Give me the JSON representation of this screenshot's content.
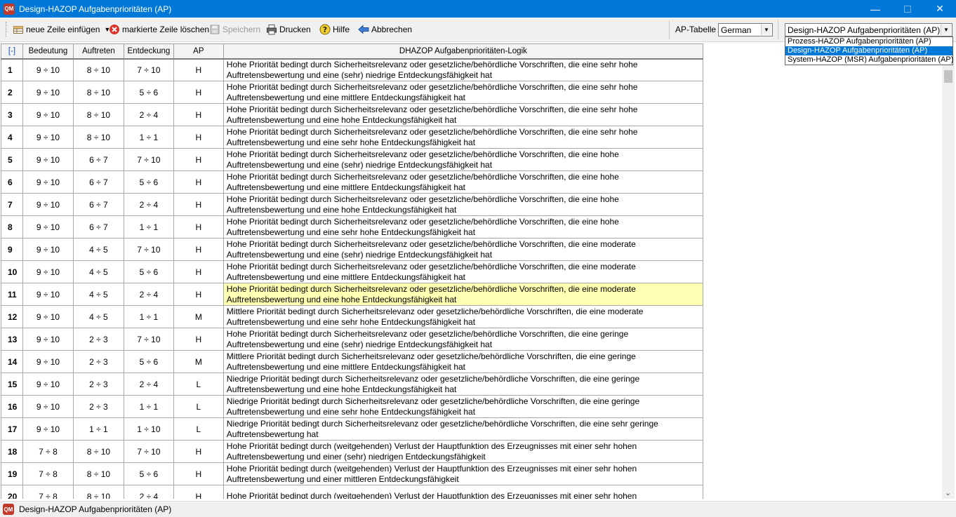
{
  "window": {
    "title": "Design-HAZOP Aufgabenprioritäten (AP)",
    "app_icon_text": "QM",
    "min_glyph": "—",
    "close_glyph": "✕"
  },
  "toolbar": {
    "insert_row": "neue Zeile einfügen",
    "delete_row": "markierte Zeile löschen",
    "save": "Speichern",
    "print": "Drucken",
    "help": "Hilfe",
    "cancel": "Abbrechen",
    "ap_table_label": "AP-Tabelle",
    "language_value": "German",
    "view_value": "Design-HAZOP Aufgabenprioritäten (AP)",
    "view_options": [
      "Prozess-HAZOP Aufgabenprioritäten (AP)",
      "Design-HAZOP Aufgabenprioritäten (AP)",
      "System-HAZOP (MSR) Aufgabenprioritäten (AP)"
    ]
  },
  "grid": {
    "columns": {
      "corner": "[-]",
      "bedeutung": "Bedeutung",
      "auftreten": "Auftreten",
      "entdeckung": "Entdeckung",
      "ap": "AP",
      "logic": "DHAZOP Aufgabenprioritäten-Logik"
    },
    "rows": [
      {
        "n": "1",
        "b": "9 ÷ 10",
        "a": "8 ÷ 10",
        "e": "7 ÷ 10",
        "ap": "H",
        "logic1": "Hohe Priorität bedingt durch Sicherheitsrelevanz oder gesetzliche/behördliche Vorschriften, die eine sehr hohe",
        "logic2": "Auftretensbewertung und eine (sehr) niedrige Entdeckungsfähigkeit hat"
      },
      {
        "n": "2",
        "b": "9 ÷ 10",
        "a": "8 ÷ 10",
        "e": "5 ÷ 6",
        "ap": "H",
        "logic1": "Hohe Priorität bedingt durch Sicherheitsrelevanz oder gesetzliche/behördliche Vorschriften, die eine sehr hohe",
        "logic2": "Auftretensbewertung und eine mittlere Entdeckungsfähigkeit hat"
      },
      {
        "n": "3",
        "b": "9 ÷ 10",
        "a": "8 ÷ 10",
        "e": "2 ÷ 4",
        "ap": "H",
        "logic1": "Hohe Priorität bedingt durch Sicherheitsrelevanz oder gesetzliche/behördliche Vorschriften, die eine sehr hohe",
        "logic2": "Auftretensbewertung und eine hohe Entdeckungsfähigkeit hat"
      },
      {
        "n": "4",
        "b": "9 ÷ 10",
        "a": "8 ÷ 10",
        "e": "1 ÷ 1",
        "ap": "H",
        "logic1": "Hohe Priorität bedingt durch Sicherheitsrelevanz oder gesetzliche/behördliche Vorschriften, die eine sehr hohe",
        "logic2": "Auftretensbewertung und eine sehr hohe Entdeckungsfähigkeit hat"
      },
      {
        "n": "5",
        "b": "9 ÷ 10",
        "a": "6 ÷ 7",
        "e": "7 ÷ 10",
        "ap": "H",
        "logic1": "Hohe Priorität bedingt durch Sicherheitsrelevanz oder gesetzliche/behördliche Vorschriften, die eine hohe",
        "logic2": "Auftretensbewertung und eine (sehr) niedrige Entdeckungsfähigkeit hat"
      },
      {
        "n": "6",
        "b": "9 ÷ 10",
        "a": "6 ÷ 7",
        "e": "5 ÷ 6",
        "ap": "H",
        "logic1": "Hohe Priorität bedingt durch Sicherheitsrelevanz oder gesetzliche/behördliche Vorschriften, die eine hohe",
        "logic2": "Auftretensbewertung und eine mittlere Entdeckungsfähigkeit hat"
      },
      {
        "n": "7",
        "b": "9 ÷ 10",
        "a": "6 ÷ 7",
        "e": "2 ÷ 4",
        "ap": "H",
        "logic1": "Hohe Priorität bedingt durch Sicherheitsrelevanz oder gesetzliche/behördliche Vorschriften, die eine hohe",
        "logic2": "Auftretensbewertung und eine hohe Entdeckungsfähigkeit hat"
      },
      {
        "n": "8",
        "b": "9 ÷ 10",
        "a": "6 ÷ 7",
        "e": "1 ÷ 1",
        "ap": "H",
        "logic1": "Hohe Priorität bedingt durch Sicherheitsrelevanz oder gesetzliche/behördliche Vorschriften, die eine hohe",
        "logic2": "Auftretensbewertung und eine sehr hohe Entdeckungsfähigkeit hat"
      },
      {
        "n": "9",
        "b": "9 ÷ 10",
        "a": "4 ÷ 5",
        "e": "7 ÷ 10",
        "ap": "H",
        "logic1": "Hohe Priorität bedingt durch Sicherheitsrelevanz oder gesetzliche/behördliche Vorschriften, die eine moderate",
        "logic2": "Auftretensbewertung und eine (sehr) niedrige Entdeckungsfähigkeit hat"
      },
      {
        "n": "10",
        "b": "9 ÷ 10",
        "a": "4 ÷ 5",
        "e": "5 ÷ 6",
        "ap": "H",
        "logic1": "Hohe Priorität bedingt durch Sicherheitsrelevanz oder gesetzliche/behördliche Vorschriften, die eine moderate",
        "logic2": "Auftretensbewertung und eine mittlere Entdeckungsfähigkeit hat"
      },
      {
        "n": "11",
        "b": "9 ÷ 10",
        "a": "4 ÷ 5",
        "e": "2 ÷ 4",
        "ap": "H",
        "logic1": "Hohe Priorität bedingt durch Sicherheitsrelevanz oder gesetzliche/behördliche Vorschriften, die eine moderate",
        "logic2": "Auftretensbewertung und eine hohe Entdeckungsfähigkeit hat"
      },
      {
        "n": "12",
        "b": "9 ÷ 10",
        "a": "4 ÷ 5",
        "e": "1 ÷ 1",
        "ap": "M",
        "logic1": "Mittlere Priorität bedingt durch Sicherheitsrelevanz oder gesetzliche/behördliche Vorschriften, die eine moderate",
        "logic2": "Auftretensbewertung und eine sehr hohe Entdeckungsfähigkeit hat"
      },
      {
        "n": "13",
        "b": "9 ÷ 10",
        "a": "2 ÷ 3",
        "e": "7 ÷ 10",
        "ap": "H",
        "logic1": "Hohe Priorität bedingt durch Sicherheitsrelevanz oder gesetzliche/behördliche Vorschriften, die eine geringe",
        "logic2": "Auftretensbewertung und eine (sehr) niedrige Entdeckungsfähigkeit hat"
      },
      {
        "n": "14",
        "b": "9 ÷ 10",
        "a": "2 ÷ 3",
        "e": "5 ÷ 6",
        "ap": "M",
        "logic1": "Mittlere Priorität bedingt durch Sicherheitsrelevanz oder gesetzliche/behördliche Vorschriften, die eine geringe",
        "logic2": "Auftretensbewertung und eine mittlere Entdeckungsfähigkeit hat"
      },
      {
        "n": "15",
        "b": "9 ÷ 10",
        "a": "2 ÷ 3",
        "e": "2 ÷ 4",
        "ap": "L",
        "logic1": "Niedrige Priorität bedingt durch Sicherheitsrelevanz oder gesetzliche/behördliche Vorschriften, die eine geringe",
        "logic2": "Auftretensbewertung und eine hohe Entdeckungsfähigkeit hat"
      },
      {
        "n": "16",
        "b": "9 ÷ 10",
        "a": "2 ÷ 3",
        "e": "1 ÷ 1",
        "ap": "L",
        "logic1": "Niedrige Priorität bedingt durch Sicherheitsrelevanz oder gesetzliche/behördliche Vorschriften, die eine geringe",
        "logic2": "Auftretensbewertung und eine sehr hohe Entdeckungsfähigkeit hat"
      },
      {
        "n": "17",
        "b": "9 ÷ 10",
        "a": "1 ÷ 1",
        "e": "1 ÷ 10",
        "ap": "L",
        "logic1": "Niedrige Priorität bedingt durch Sicherheitsrelevanz oder gesetzliche/behördliche Vorschriften, die eine sehr geringe",
        "logic2": "Auftretensbewertung hat"
      },
      {
        "n": "18",
        "b": "7 ÷ 8",
        "a": "8 ÷ 10",
        "e": "7 ÷ 10",
        "ap": "H",
        "logic1": "Hohe Priorität bedingt durch (weitgehenden) Verlust der Hauptfunktion des Erzeugnisses mit einer sehr hohen",
        "logic2": "Auftretensbewertung und einer (sehr) niedrigen Entdeckungsfähigkeit"
      },
      {
        "n": "19",
        "b": "7 ÷ 8",
        "a": "8 ÷ 10",
        "e": "5 ÷ 6",
        "ap": "H",
        "logic1": "Hohe Priorität bedingt durch (weitgehenden) Verlust der Hauptfunktion des Erzeugnisses mit einer sehr hohen",
        "logic2": "Auftretensbewertung und einer mittleren Entdeckungsfähigkeit"
      },
      {
        "n": "20",
        "b": "7 ÷ 8",
        "a": "8 ÷ 10",
        "e": "2 ÷ 4",
        "ap": "H",
        "logic1": "Hohe Priorität bedingt durch (weitgehenden) Verlust der Hauptfunktion des Erzeugnisses mit einer sehr hohen",
        "logic2": ""
      }
    ],
    "highlighted_row": "11"
  },
  "statusbar": {
    "text": "Design-HAZOP Aufgabenprioritäten (AP)"
  },
  "colors": {
    "titlebar": "#0078d7",
    "highlight": "#ffffb3",
    "selection": "#0078d7"
  }
}
